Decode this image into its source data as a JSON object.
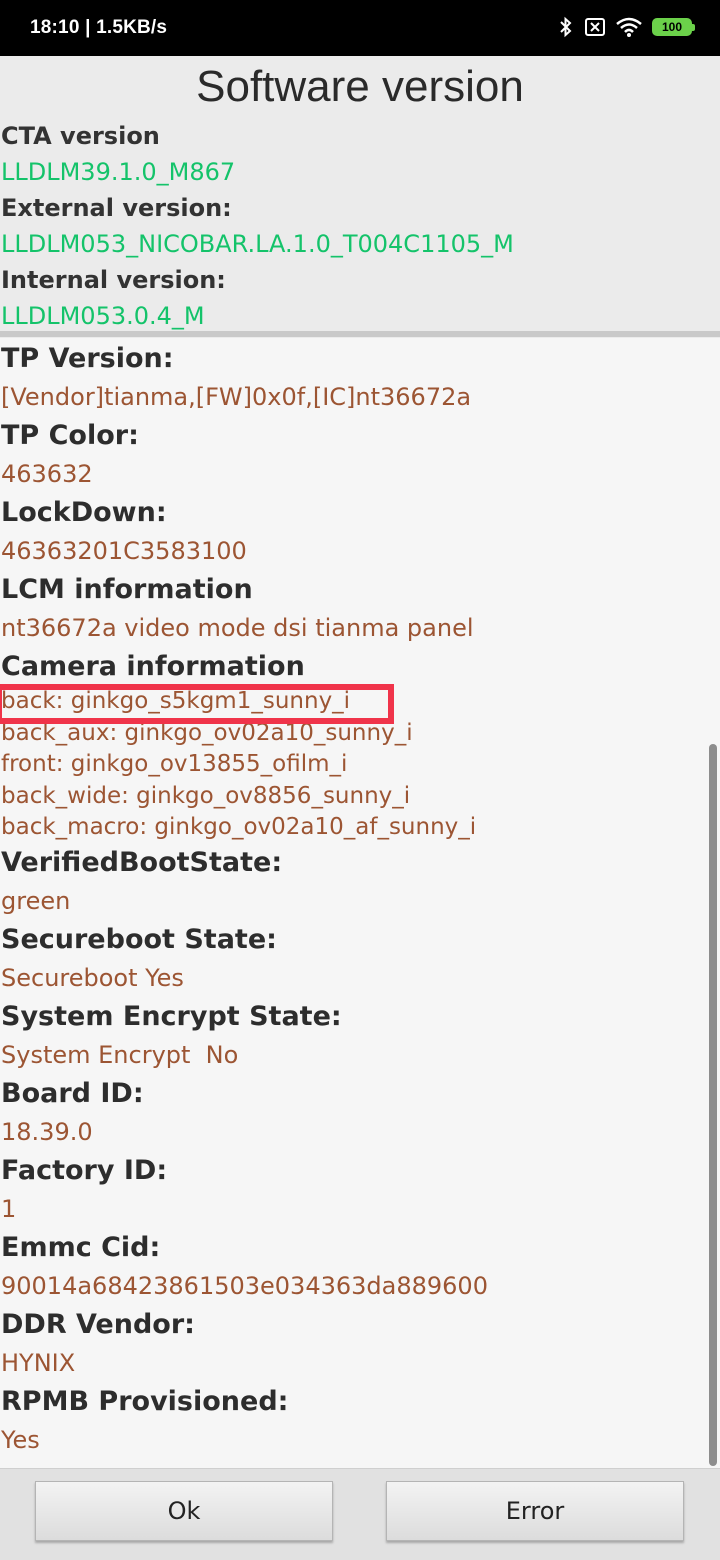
{
  "status_bar": {
    "time_speed": "18:10 | 1.5KB/s",
    "battery": "100"
  },
  "title": "Software version",
  "versions": [
    {
      "label": "CTA version",
      "value": "LLDLM39.1.0_M867"
    },
    {
      "label": "External version:",
      "value": "LLDLM053_NICOBAR.LA.1.0_T004C1105_M"
    },
    {
      "label": "Internal version:",
      "value": "LLDLM053.0.4_M"
    }
  ],
  "info": {
    "tp_version": {
      "label": "TP Version:",
      "value": "[Vendor]tianma,[FW]0x0f,[IC]nt36672a"
    },
    "tp_color": {
      "label": "TP Color:",
      "value": "463632"
    },
    "lockdown": {
      "label": "LockDown:",
      "value": "46363201C3583100"
    },
    "lcm": {
      "label": "LCM information",
      "value": "nt36672a video mode dsi tianma panel"
    },
    "camera": {
      "label": "Camera information",
      "lines": [
        "back: ginkgo_s5kgm1_sunny_i",
        "back_aux: ginkgo_ov02a10_sunny_i",
        "front: ginkgo_ov13855_ofilm_i",
        "back_wide: ginkgo_ov8856_sunny_i",
        "back_macro: ginkgo_ov02a10_af_sunny_i"
      ]
    },
    "verified_boot": {
      "label": "VerifiedBootState:",
      "value": "green"
    },
    "secureboot": {
      "label": "Secureboot State:",
      "value": "Secureboot Yes"
    },
    "encrypt": {
      "label": "System Encrypt State:",
      "value": "System Encrypt  No"
    },
    "board_id": {
      "label": "Board ID:",
      "value": "18.39.0"
    },
    "factory_id": {
      "label": "Factory ID:",
      "value": "1"
    },
    "emmc_cid": {
      "label": "Emmc Cid:",
      "value": "90014a68423861503e034363da889600"
    },
    "ddr_vendor": {
      "label": "DDR Vendor:",
      "value": "HYNIX"
    },
    "rpmb": {
      "label": "RPMB Provisioned:",
      "value": "Yes"
    }
  },
  "buttons": {
    "ok": "Ok",
    "error": "Error"
  },
  "colors": {
    "version_value": "#14c36a",
    "info_value": "#9c5533",
    "highlight": "#f0344a"
  }
}
